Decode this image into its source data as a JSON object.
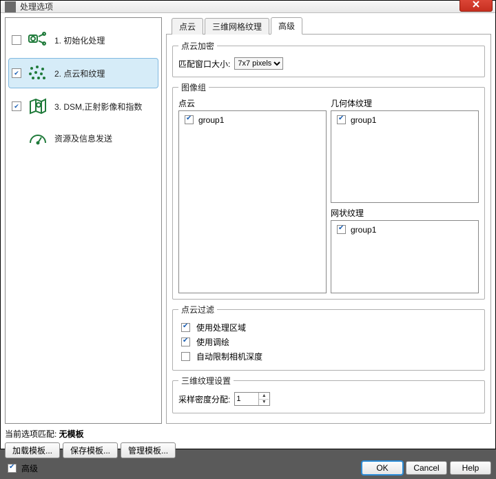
{
  "window": {
    "title": "处理选项"
  },
  "sidebar": {
    "steps": [
      {
        "checked": false,
        "label": "1. 初始化处理"
      },
      {
        "checked": true,
        "label": "2. 点云和纹理"
      },
      {
        "checked": true,
        "label": "3. DSM,正射影像和指数"
      },
      {
        "checked": false,
        "label": "资源及信息发送"
      }
    ]
  },
  "tabs": {
    "items": [
      "点云",
      "三维网格纹理",
      "高级"
    ],
    "active_index": 2
  },
  "densify": {
    "legend": "点云加密",
    "window_label": "匹配窗口大小:",
    "window_value": "7x7 pixels"
  },
  "image_groups": {
    "legend": "图像组",
    "pointcloud_label": "点云",
    "pointcloud_items": [
      {
        "checked": true,
        "name": "group1"
      }
    ],
    "geom_label": "几何体纹理",
    "geom_items": [
      {
        "checked": true,
        "name": "group1"
      }
    ],
    "mesh_label": "网状纹理",
    "mesh_items": [
      {
        "checked": true,
        "name": "group1"
      }
    ]
  },
  "filter": {
    "legend": "点云过滤",
    "use_area": {
      "checked": true,
      "label": "使用处理区域"
    },
    "use_annotation": {
      "checked": true,
      "label": "使用调绘"
    },
    "auto_limit": {
      "checked": false,
      "label": "自动限制相机深度"
    }
  },
  "texture": {
    "legend": "三维纹理设置",
    "sampling_label": "采样密度分配:",
    "sampling_value": "1"
  },
  "template_match": {
    "prefix": "当前选项匹配: ",
    "value": "无模板"
  },
  "template_buttons": {
    "load": "加载模板...",
    "save": "保存模板...",
    "manage": "管理模板..."
  },
  "advanced_check": {
    "checked": true,
    "label": "高级"
  },
  "footer_buttons": {
    "ok": "OK",
    "cancel": "Cancel",
    "help": "Help"
  }
}
